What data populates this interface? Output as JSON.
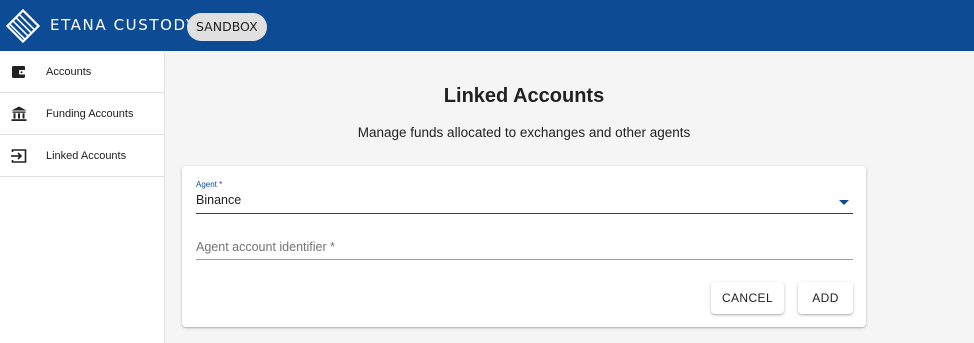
{
  "header": {
    "brand": "ETANA CUSTODY",
    "environment_badge": "SANDBOX",
    "brand_color": "#0d4c95"
  },
  "sidebar": {
    "items": [
      {
        "label": "Accounts",
        "icon": "wallet-icon"
      },
      {
        "label": "Funding Accounts",
        "icon": "bank-icon"
      },
      {
        "label": "Linked Accounts",
        "icon": "link-arrow-icon"
      }
    ]
  },
  "main": {
    "title": "Linked Accounts",
    "subtitle": "Manage funds allocated to exchanges and other agents",
    "form": {
      "agent_label": "Agent *",
      "agent_value": "Binance",
      "identifier_placeholder": "Agent account identifier *",
      "identifier_value": "",
      "cancel_label": "CANCEL",
      "add_label": "ADD"
    }
  }
}
